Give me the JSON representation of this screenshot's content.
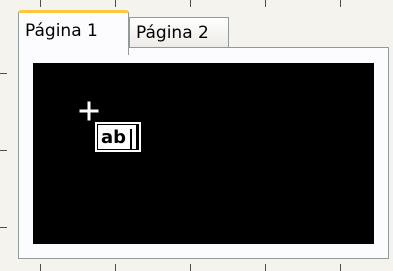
{
  "tabs": [
    {
      "label": "Página 1",
      "active": true
    },
    {
      "label": "Página 2",
      "active": false
    }
  ],
  "canvas": {
    "control_label": "ab",
    "cursor_icon": "crosshair-icon",
    "background_color": "#000000"
  },
  "colors": {
    "active_tab_accent": "#ffc83c",
    "border": "#919b9c"
  }
}
